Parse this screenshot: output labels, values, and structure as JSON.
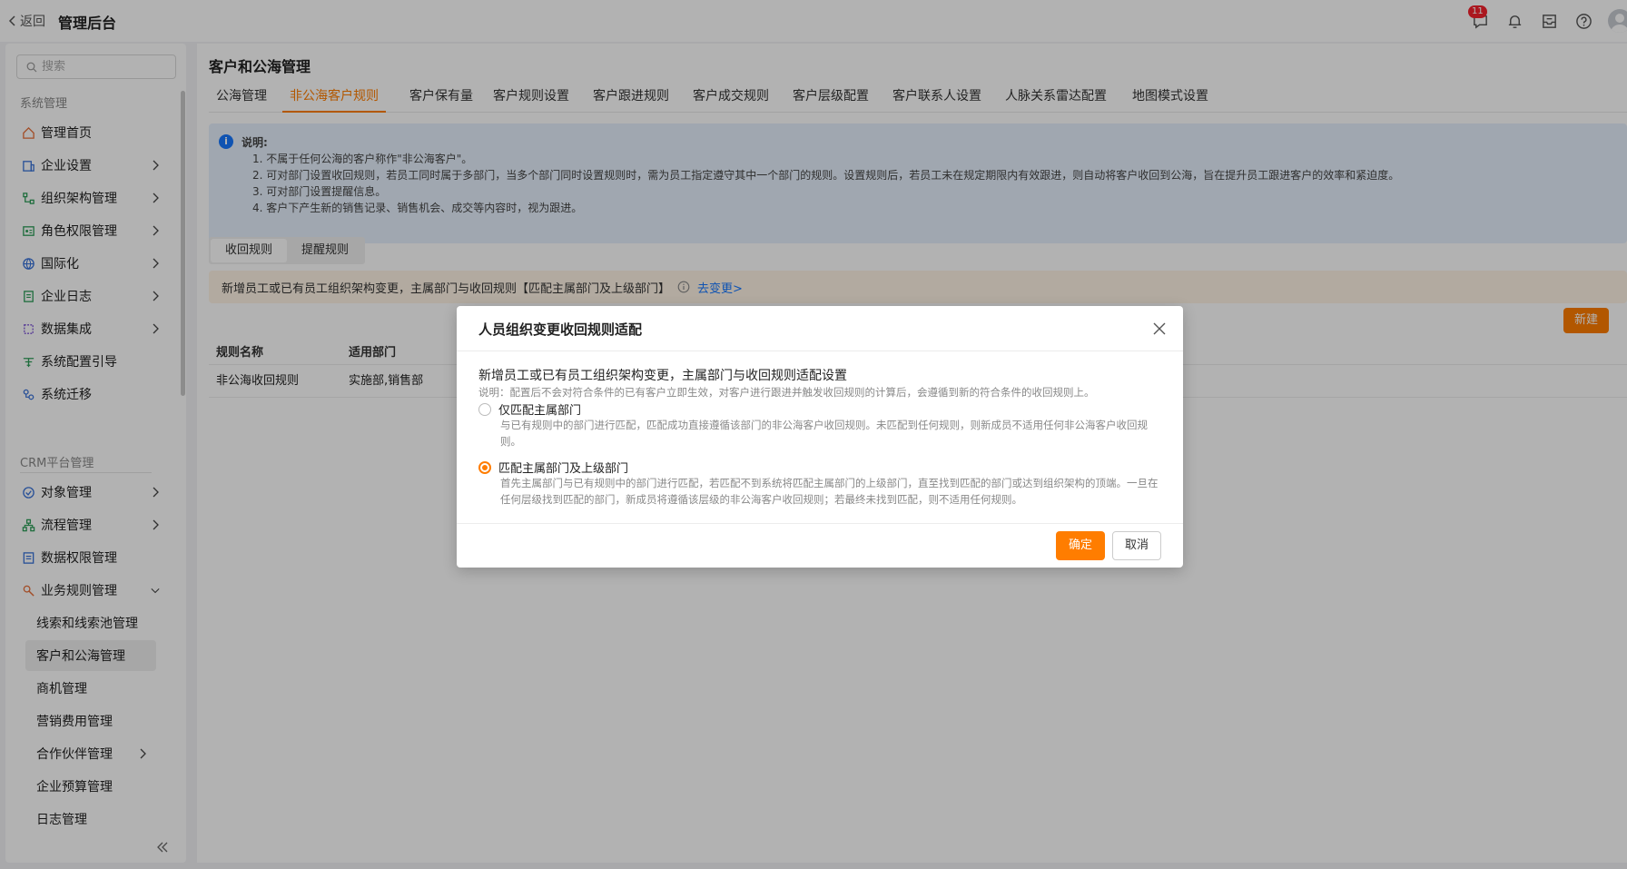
{
  "header": {
    "back_label": "返回",
    "app_title": "管理后台",
    "message_badge": "11"
  },
  "sidebar": {
    "search_placeholder": "搜索",
    "group1_label": "系统管理",
    "group1_items": [
      {
        "label": "管理首页",
        "icon": "home-icon"
      },
      {
        "label": "企业设置",
        "icon": "enterprise-icon"
      },
      {
        "label": "组织架构管理",
        "icon": "org-icon"
      },
      {
        "label": "角色权限管理",
        "icon": "role-icon"
      },
      {
        "label": "国际化",
        "icon": "globe-icon"
      },
      {
        "label": "企业日志",
        "icon": "log-icon"
      },
      {
        "label": "数据集成",
        "icon": "integration-icon"
      },
      {
        "label": "系统配置引导",
        "icon": "guide-icon"
      },
      {
        "label": "系统迁移",
        "icon": "migrate-icon"
      }
    ],
    "group2_label": "CRM平台管理",
    "group2_items": [
      {
        "label": "对象管理",
        "icon": "object-icon"
      },
      {
        "label": "流程管理",
        "icon": "flow-icon"
      },
      {
        "label": "数据权限管理",
        "icon": "data-permission-icon"
      },
      {
        "label": "业务规则管理",
        "icon": "rule-icon"
      }
    ],
    "sub_items": [
      {
        "label": "线索和线索池管理"
      },
      {
        "label": "客户和公海管理"
      },
      {
        "label": "商机管理"
      },
      {
        "label": "营销费用管理"
      },
      {
        "label": "合作伙伴管理"
      },
      {
        "label": "企业预算管理"
      },
      {
        "label": "日志管理"
      }
    ]
  },
  "main": {
    "page_title": "客户和公海管理",
    "tabs": [
      {
        "label": "公海管理"
      },
      {
        "label": "非公海客户规则"
      },
      {
        "label": "客户保有量"
      },
      {
        "label": "客户规则设置"
      },
      {
        "label": "客户跟进规则"
      },
      {
        "label": "客户成交规则"
      },
      {
        "label": "客户层级配置"
      },
      {
        "label": "客户联系人设置"
      },
      {
        "label": "人脉关系雷达配置"
      },
      {
        "label": "地图模式设置"
      }
    ],
    "info": {
      "title": "说明:",
      "lines": [
        "1. 不属于任何公海的客户称作\"非公海客户\"。",
        "2. 可对部门设置收回规则，若员工同时属于多部门，当多个部门同时设置规则时，需为员工指定遵守其中一个部门的规则。设置规则后，若员工未在规定期限内有效跟进，则自动将客户收回到公海，旨在提升员工跟进客户的效率和紧迫度。",
        "3. 可对部门设置提醒信息。",
        "4. 客户下产生新的销售记录、销售机会、成交等内容时，视为跟进。"
      ]
    },
    "sub_tabs": [
      {
        "label": "收回规则"
      },
      {
        "label": "提醒规则"
      }
    ],
    "warn_text": "新增员工或已有员工组织架构变更，主属部门与收回规则【匹配主属部门及上级部门】",
    "warn_link": "去变更>",
    "new_button": "新建",
    "table": {
      "headers": [
        "规则名称",
        "适用部门"
      ],
      "rows": [
        [
          "非公海收回规则",
          "实施部,销售部"
        ]
      ]
    }
  },
  "modal": {
    "title": "人员组织变更收回规则适配",
    "section_title": "新增员工或已有员工组织架构变更，主属部门与收回规则适配设置",
    "note": "说明：配置后不会对符合条件的已有客户立即生效，对客户进行跟进并触发收回规则的计算后，会遵循到新的符合条件的收回规则上。",
    "options": [
      {
        "label": "仅匹配主属部门",
        "desc": "与已有规则中的部门进行匹配，匹配成功直接遵循该部门的非公海客户收回规则。未匹配到任何规则，则新成员不适用任何非公海客户收回规则。",
        "checked": false
      },
      {
        "label": "匹配主属部门及上级部门",
        "desc": "首先主属部门与已有规则中的部门进行匹配，若匹配不到系统将匹配主属部门的上级部门，直至找到匹配的部门或达到组织架构的顶端。一旦在任何层级找到匹配的部门，新成员将遵循该层级的非公海客户收回规则；若最终未找到匹配，则不适用任何规则。",
        "checked": true
      }
    ],
    "ok_label": "确定",
    "cancel_label": "取消"
  },
  "colors": {
    "accent": "#ff7d00",
    "link": "#1677ff",
    "info_bg": "#e6f0fc",
    "warn_bg": "#fff4e6",
    "badge": "#f5222d"
  }
}
